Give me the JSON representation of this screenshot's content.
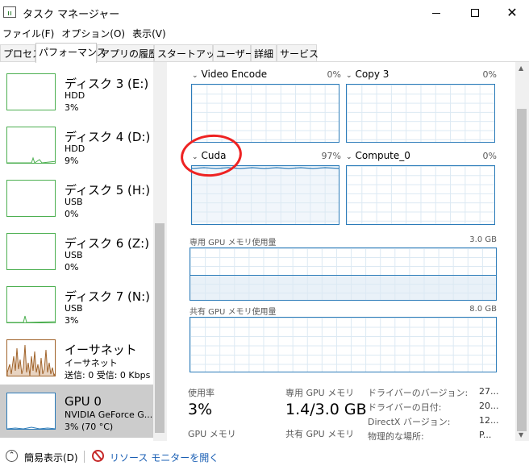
{
  "window": {
    "title": "タスク マネージャー",
    "close_glyph": "✕"
  },
  "menu": [
    "ファイル(F)",
    "オプション(O)",
    "表示(V)"
  ],
  "tabs": [
    "プロセス",
    "パフォーマンス",
    "アプリの履歴",
    "スタートアップ",
    "ユーザー",
    "詳細",
    "サービス"
  ],
  "active_tab": "パフォーマンス",
  "sidebar": [
    {
      "name": "ディスク 3 (E:)",
      "sub1": "HDD",
      "sub2": "3%",
      "type": "disk"
    },
    {
      "name": "ディスク 4 (D:)",
      "sub1": "HDD",
      "sub2": "9%",
      "type": "disk"
    },
    {
      "name": "ディスク 5 (H:)",
      "sub1": "USB",
      "sub2": "0%",
      "type": "disk"
    },
    {
      "name": "ディスク 6 (Z:)",
      "sub1": "USB",
      "sub2": "0%",
      "type": "disk"
    },
    {
      "name": "ディスク 7 (N:)",
      "sub1": "USB",
      "sub2": "3%",
      "type": "disk"
    },
    {
      "name": "イーサネット",
      "sub1": "イーサネット",
      "sub2": "送信: 0 受信: 0 Kbps",
      "type": "ethernet"
    },
    {
      "name": "GPU 0",
      "sub1": "NVIDIA GeForce G...",
      "sub2": "3% (70 °C)",
      "type": "gpu",
      "selected": true
    }
  ],
  "engines": [
    {
      "name": "Video Encode",
      "percent": "0%",
      "level": 0.0
    },
    {
      "name": "Copy 3",
      "percent": "0%",
      "level": 0.0
    },
    {
      "name": "Cuda",
      "percent": "97%",
      "level": 0.97
    },
    {
      "name": "Compute_0",
      "percent": "0%",
      "level": 0.0
    }
  ],
  "dedicated_memory": {
    "label": "専用 GPU メモリ使用量",
    "max": "3.0 GB",
    "fill_fraction": 0.47
  },
  "shared_memory": {
    "label": "共有 GPU メモリ使用量",
    "max": "8.0 GB",
    "fill_fraction": 0.0
  },
  "stats": {
    "utilization_label": "使用率",
    "utilization_value": "3%",
    "dedicated_label": "専用 GPU メモリ",
    "dedicated_value": "1.4/3.0 GB",
    "gpu_memory_label": "GPU メモリ",
    "shared_label": "共有 GPU メモリ"
  },
  "info": [
    {
      "label": "ドライバーのバージョン:",
      "value": "27..."
    },
    {
      "label": "ドライバーの日付:",
      "value": "20..."
    },
    {
      "label": "DirectX バージョン:",
      "value": "12..."
    },
    {
      "label": "物理的な場所:",
      "value": "P..."
    }
  ],
  "footer": {
    "compact_label": "簡易表示(D)",
    "resource_monitor_label": "リソース モニターを開く"
  },
  "colors": {
    "disk": "#4caf50",
    "ethernet": "#a0632a",
    "gpu": "#2b7bb9",
    "annotation": "#ee2222"
  }
}
